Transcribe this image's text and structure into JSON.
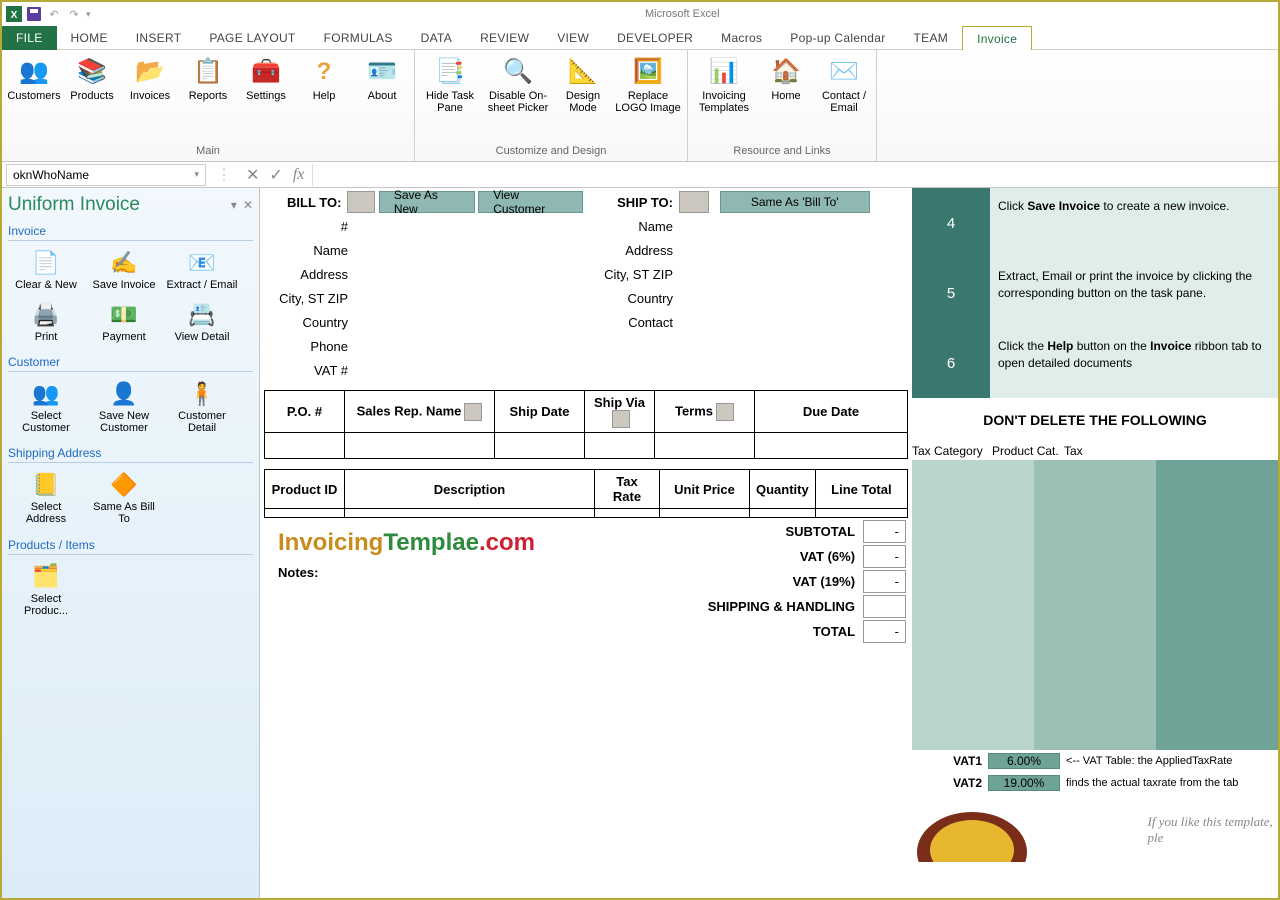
{
  "app_title": "Microsoft Excel",
  "menu": {
    "file": "FILE",
    "home": "HOME",
    "insert": "INSERT",
    "page": "PAGE LAYOUT",
    "formulas": "FORMULAS",
    "data": "DATA",
    "review": "REVIEW",
    "view": "VIEW",
    "developer": "DEVELOPER",
    "macros": "Macros",
    "popup": "Pop-up Calendar",
    "team": "TEAM",
    "invoice": "Invoice"
  },
  "ribbon": {
    "main": {
      "label": "Main",
      "items": [
        "Customers",
        "Products",
        "Invoices",
        "Reports",
        "Settings",
        "Help",
        "About"
      ]
    },
    "customize": {
      "label": "Customize and Design",
      "items": [
        "Hide Task Pane",
        "Disable On-sheet Picker",
        "Design Mode",
        "Replace LOGO Image"
      ]
    },
    "resource": {
      "label": "Resource and Links",
      "items": [
        "Invoicing Templates",
        "Home",
        "Contact / Email"
      ]
    }
  },
  "namebox": "oknWhoName",
  "taskpane": {
    "title": "Uniform Invoice",
    "sections": {
      "invoice": {
        "title": "Invoice",
        "items": [
          "Clear & New",
          "Save Invoice",
          "Extract / Email",
          "Print",
          "Payment",
          "View Detail"
        ]
      },
      "customer": {
        "title": "Customer",
        "items": [
          "Select Customer",
          "Save New Customer",
          "Customer Detail"
        ]
      },
      "shipping": {
        "title": "Shipping Address",
        "items": [
          "Select Address",
          "Same As Bill To"
        ]
      },
      "products": {
        "title": "Products / Items",
        "items": [
          "Select Produc..."
        ]
      }
    }
  },
  "invoice": {
    "bill_to": "BILL TO:",
    "ship_to": "SHIP TO:",
    "save_as_new": "Save As New",
    "view_customer": "View Customer",
    "same_as": "Same As 'Bill To'",
    "bill_labels": [
      "#",
      "Name",
      "Address",
      "City, ST ZIP",
      "Country",
      "Phone",
      "VAT #"
    ],
    "ship_labels": [
      "Name",
      "Address",
      "City, ST ZIP",
      "Country",
      "Contact"
    ],
    "po_cols": [
      "P.O. #",
      "Sales Rep. Name",
      "Ship Date",
      "Ship Via",
      "Terms",
      "Due Date"
    ],
    "item_cols": [
      "Product ID",
      "Description",
      "Tax Rate",
      "Unit Price",
      "Quantity",
      "Line Total"
    ],
    "totals": {
      "subtotal": "SUBTOTAL",
      "vat6": "VAT (6%)",
      "vat19": "VAT (19%)",
      "shipping": "SHIPPING & HANDLING",
      "total": "TOTAL"
    },
    "dash": "-",
    "notes": "Notes:",
    "logo": "InvoicingTemplae.com"
  },
  "tips": {
    "n4": "4",
    "t4a": "Click ",
    "t4b": "Save Invoice",
    "t4c": " to create a new invoice.",
    "n5": "5",
    "t5": "Extract, Email or print the invoice by clicking the corresponding button on the task pane.",
    "n6": "6",
    "t6a": "Click the ",
    "t6b": "Help",
    "t6c": " button on the ",
    "t6d": "Invoice",
    "t6e": " ribbon tab to open detailed documents",
    "nodel": "DON'T DELETE THE FOLLOWING",
    "cat": [
      "Tax Category",
      "Product Cat.",
      "Tax"
    ],
    "vat1": {
      "l": "VAT1",
      "v": "6.00%",
      "n": "<-- VAT Table: the AppliedTaxRate"
    },
    "vat2": {
      "l": "VAT2",
      "v": "19.00%",
      "n": "finds the actual taxrate from the tab"
    },
    "like": "If you like this template, ple"
  }
}
